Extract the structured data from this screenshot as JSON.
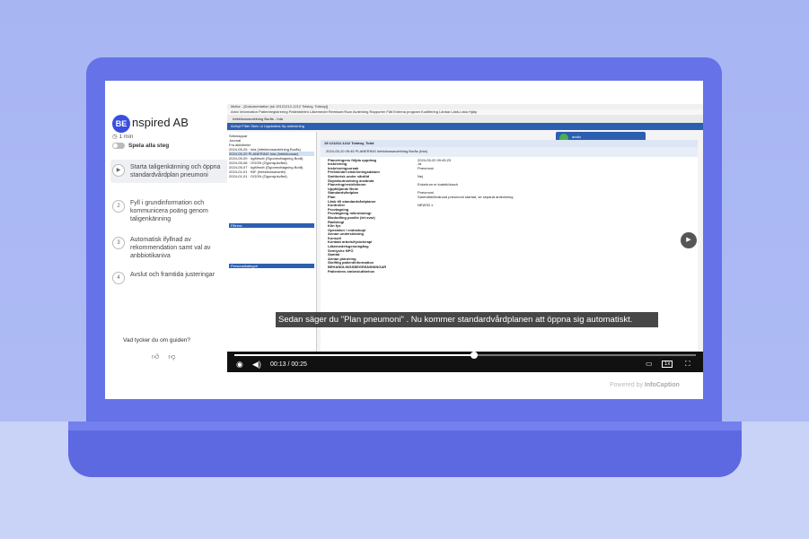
{
  "guide": {
    "brand_prefix": "BE",
    "brand_rest": "nspired AB",
    "duration": "1 min",
    "play_all": "Spela alla steg",
    "steps": [
      {
        "num": "▶",
        "label": "Starta taligenkänning och öppna standardvårdplan pneumoni"
      },
      {
        "num": "2",
        "label": "Fyll i grundinformation och kommunicera poäng genom taligenkänning"
      },
      {
        "num": "3",
        "label": "Automatisk ifyllnad av rekommendation samt val av anbbiotikaniva"
      },
      {
        "num": "4",
        "label": "Avslut och framtida justeringar"
      }
    ],
    "feedback_question": "Vad tycker du om guiden?"
  },
  "app": {
    "title": "Melior - [Dokumentation (sk 19121212-1212 Tolstoy, Tolstoy)]",
    "menu": "Arkiv  Information  Patientregistrering  Patientdelen  Läkemedel  Remisser/Svar  Avdelning  Rapporter  Fält  Externa program  Kodifiering  Länkar  Länk-Lista  Hjälp",
    "toolbar": "Infektionsavdelning Borås - Inla",
    "bluebar": "Avbryt  Filter  Skriv ut  Uppdatera  Ny anteckning",
    "left_items": [
      "Sökmappar",
      "Journal",
      "Fra aktiviteter",
      "2024-05-25 · inla (Infektionsavdelning Borås)",
      "2024-05-20 PLANERING Inla (Infektionsav)",
      "2024-05-09 · ögMmott (Ögonmottagning Borå)",
      "2024-05-08 · OGON (Ögonsjukvård)",
      "2024-05-07 · ögMmott (Ögonmottagning Borå)",
      "2024-01-01 · INF (Infektionsavsnitt)",
      "2024-01-01 · OGON (Ögonsjukvård)"
    ],
    "left_section_filter": "Filtrera",
    "left_section_personal": "Personalkategori",
    "main_header": "19 121212-1212  Tolstoy, Tolst",
    "entry_header": "2024-05-20 09:45   PLANERING  Infektionsavdelning Borås (Inla)",
    "rows": [
      {
        "k": "Planeringens följda uppdrag",
        "v": "2024-05-20 09:45:23"
      },
      {
        "k": "Inskrivning",
        "v": "Ja"
      },
      {
        "k": "Inskrivningsorsak",
        "v": "Pneumoni"
      },
      {
        "k": "Preliminärt utskrivningsdatum",
        "v": ""
      },
      {
        "k": "Smittorisk under vårdtid",
        "v": "Nej"
      },
      {
        "k": "Skyddsutrustning använda",
        "v": ""
      },
      {
        "k": "Planering/restriktioner",
        "v": "Enkelrum m toalett/dusch"
      },
      {
        "k": "Uppföljande Bede",
        "v": ""
      },
      {
        "k": "Standardvårdplan",
        "v": "Pneumoni"
      },
      {
        "k": "Plan",
        "v": "Samhällsförvärvad pneumoni startad, se separat anteckning"
      },
      {
        "k": "Länk till standardvårdplaner",
        "v": ""
      },
      {
        "k": "Kontroller",
        "v": "NEWS2 x"
      },
      {
        "k": "Provtagning",
        "v": ""
      },
      {
        "k": "Provtagning mikrobiologi",
        "v": ""
      },
      {
        "k": "Blododling positiv (tel.svar)",
        "v": ""
      },
      {
        "k": "Radiologi",
        "v": ""
      },
      {
        "k": "Klin fys",
        "v": ""
      },
      {
        "k": "Operation / endoskopi",
        "v": ""
      },
      {
        "k": "Annan undersökning",
        "v": ""
      },
      {
        "k": "Konsult",
        "v": ""
      },
      {
        "k": "Kontakt arbets/fysioterapi",
        "v": ""
      },
      {
        "k": "Läkemedelsgenomgång",
        "v": ""
      },
      {
        "k": "Semiyche NPÖ",
        "v": ""
      },
      {
        "k": "Samtal",
        "v": ""
      },
      {
        "k": "Annan planering",
        "v": ""
      },
      {
        "k": "Skriftlig patientinformation",
        "v": ""
      },
      {
        "k": "BEHANDLINGSBEGRÄNSNINGAR",
        "v": ""
      },
      {
        "k": "Patientens ómbesluttbehov",
        "v": ""
      }
    ],
    "voice_label": "andlu"
  },
  "player": {
    "subtitle": "Sedan säger du \"Plan pneumoni\" . Nu kommer standardvårdplanen att öppna sig automatiskt.",
    "time": "00:13 / 00:25",
    "progress": 0.52,
    "speed": "1x"
  },
  "powered_by": "Powered by",
  "powered_brand": "InfoCaption"
}
